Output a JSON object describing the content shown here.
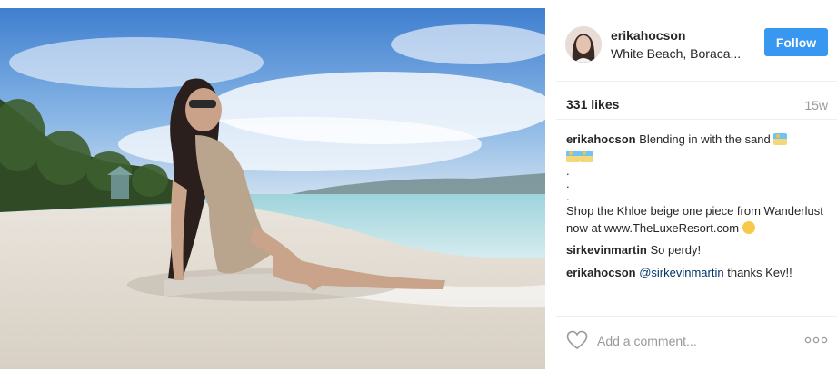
{
  "header": {
    "username": "erikahocson",
    "location": "White Beach, Boraca...",
    "follow_label": "Follow"
  },
  "stats": {
    "likes": "331 likes",
    "age": "15w"
  },
  "caption": {
    "user": "erikahocson",
    "text_1": "Blending in with the sand",
    "dots": [
      ".",
      ".",
      "."
    ],
    "text_2": "Shop the Khloe beige one piece from Wanderlust now at www.TheLuxeResort.com"
  },
  "comments": [
    {
      "user": "sirkevinmartin",
      "text": "So perdy!"
    },
    {
      "user": "erikahocson",
      "mention": "@sirkevinmartin",
      "text": "thanks Kev!!"
    }
  ],
  "add_comment": {
    "placeholder": "Add a comment..."
  },
  "icons": {
    "avatar": "avatar",
    "beach_emoji": "beach-umbrella-emoji",
    "wink_emoji": "winking-face-emoji",
    "heart": "heart-icon",
    "more": "more-options-icon"
  },
  "colors": {
    "follow_button": "#3897f0",
    "mention": "#003569",
    "muted_text": "#999999",
    "divider": "#efefef"
  }
}
